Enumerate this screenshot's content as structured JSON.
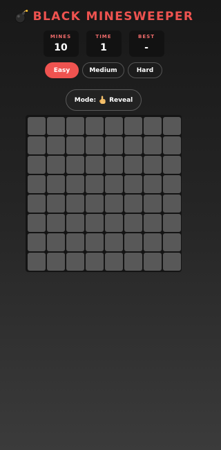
{
  "header": {
    "title": "BLACK MINESWEEPER",
    "icon": "bomb-icon"
  },
  "stats": [
    {
      "label": "MINES",
      "value": "10"
    },
    {
      "label": "TIME",
      "value": "1"
    },
    {
      "label": "BEST",
      "value": "-"
    }
  ],
  "difficulty": {
    "options": [
      "Easy",
      "Medium",
      "Hard"
    ],
    "selected": "Easy"
  },
  "mode": {
    "label": "Mode:",
    "value": "Reveal",
    "icon": "pointing-hand-icon"
  },
  "board": {
    "rows": 8,
    "cols": 8,
    "state": "unrevealed"
  },
  "colors": {
    "accent": "#ef5350",
    "cell": "#585858",
    "board": "#141414",
    "stat_box": "#121212"
  }
}
